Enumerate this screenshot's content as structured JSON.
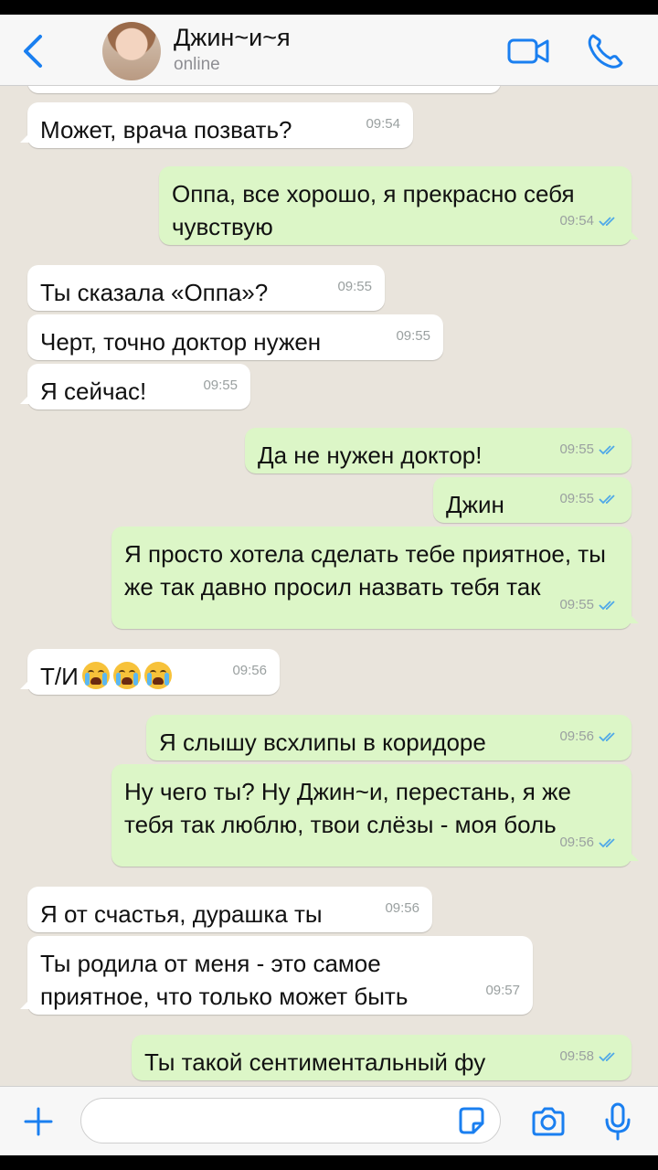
{
  "header": {
    "contact_name": "Джин~и~я",
    "status": "online"
  },
  "messages": [
    {
      "dir": "in",
      "text": "Может, врача позвать?",
      "time": "09:54"
    },
    {
      "dir": "out",
      "text": "Оппа, все хорошо, я прекрасно себя чувствую",
      "time": "09:54"
    },
    {
      "dir": "in",
      "text": "Ты сказала «Оппа»?",
      "time": "09:55"
    },
    {
      "dir": "in",
      "text": "Черт, точно доктор нужен",
      "time": "09:55"
    },
    {
      "dir": "in",
      "text": "Я сейчас!",
      "time": "09:55"
    },
    {
      "dir": "out",
      "text": "Да не нужен доктор!",
      "time": "09:55"
    },
    {
      "dir": "out",
      "text": "Джин",
      "time": "09:55"
    },
    {
      "dir": "out",
      "text": "Я просто хотела сделать тебе приятное, ты же так давно просил назвать тебя так",
      "time": "09:55"
    },
    {
      "dir": "in",
      "text": "Т/И",
      "emoji": "crying-face",
      "emoji_count": 3,
      "time": "09:56"
    },
    {
      "dir": "out",
      "text": "Я слышу всхлипы в коридоре",
      "time": "09:56"
    },
    {
      "dir": "out",
      "text": "Ну чего ты? Ну Джин~и, перестань, я же тебя так люблю, твои слёзы - моя боль",
      "time": "09:56"
    },
    {
      "dir": "in",
      "text": "Я от счастья, дурашка ты",
      "time": "09:56"
    },
    {
      "dir": "in",
      "text": "Ты родила от меня - это самое приятное, что только может быть",
      "time": "09:57"
    },
    {
      "dir": "out",
      "text": "Ты такой сентиментальный фу",
      "time": "09:58"
    }
  ],
  "input": {
    "placeholder": ""
  },
  "icons": {
    "back": "chevron-left-icon",
    "video": "video-camera-icon",
    "call": "phone-icon",
    "plus": "plus-icon",
    "sticker": "sticker-icon",
    "camera": "camera-icon",
    "mic": "microphone-icon",
    "read_receipt": "double-check-icon"
  },
  "colors": {
    "accent": "#1a7ff0",
    "outgoing_bubble": "#dcf6c7",
    "incoming_bubble": "#ffffff",
    "chat_background": "#e9e4dc",
    "read_ticks": "#4fa8e8"
  }
}
